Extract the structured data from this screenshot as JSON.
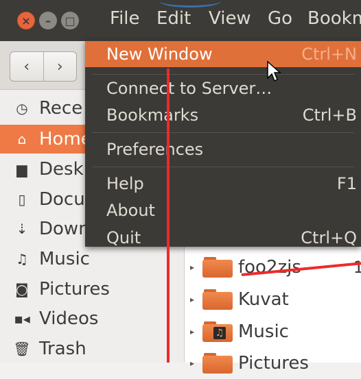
{
  "menubar": {
    "window_buttons": {
      "close": "×",
      "minimize": "–",
      "maximize": "□"
    },
    "items": [
      "File",
      "Edit",
      "View",
      "Go",
      "Bookm"
    ]
  },
  "toolbar": {
    "back_icon": "chevron-left-icon",
    "forward_icon": "chevron-right-icon"
  },
  "sidebar": {
    "items": [
      {
        "label": "Rece",
        "icon": "clock-icon",
        "selected": false
      },
      {
        "label": "Home",
        "icon": "home-icon",
        "selected": true
      },
      {
        "label": "Desk",
        "icon": "folder-icon",
        "selected": false
      },
      {
        "label": "Docu",
        "icon": "document-icon",
        "selected": false
      },
      {
        "label": "Down",
        "icon": "download-icon",
        "selected": false
      },
      {
        "label": "Music",
        "icon": "music-icon",
        "selected": false
      },
      {
        "label": "Pictures",
        "icon": "camera-icon",
        "selected": false
      },
      {
        "label": "Videos",
        "icon": "video-icon",
        "selected": false
      },
      {
        "label": "Trash",
        "icon": "trash-icon",
        "selected": false
      }
    ]
  },
  "content": {
    "rows": [
      {
        "name": "foo2zjs",
        "size": "1"
      },
      {
        "name": "Kuvat",
        "size": ""
      },
      {
        "name": "Music",
        "size": ""
      },
      {
        "name": "Pictures",
        "size": ""
      }
    ]
  },
  "file_menu": {
    "items": [
      {
        "label": "New Window",
        "accel": "Ctrl+N",
        "highlighted": true
      },
      {
        "label": "Connect to Server…",
        "accel": ""
      },
      {
        "label": "Bookmarks",
        "accel": "Ctrl+B"
      },
      {
        "label": "Preferences",
        "accel": ""
      },
      {
        "label": "Help",
        "accel": "F1"
      },
      {
        "label": "About",
        "accel": ""
      },
      {
        "label": "Quit",
        "accel": "Ctrl+Q"
      }
    ]
  },
  "colors": {
    "accent": "#ef7a45",
    "menubar": "#3c3b37",
    "annotation": "#ee2a2a"
  }
}
